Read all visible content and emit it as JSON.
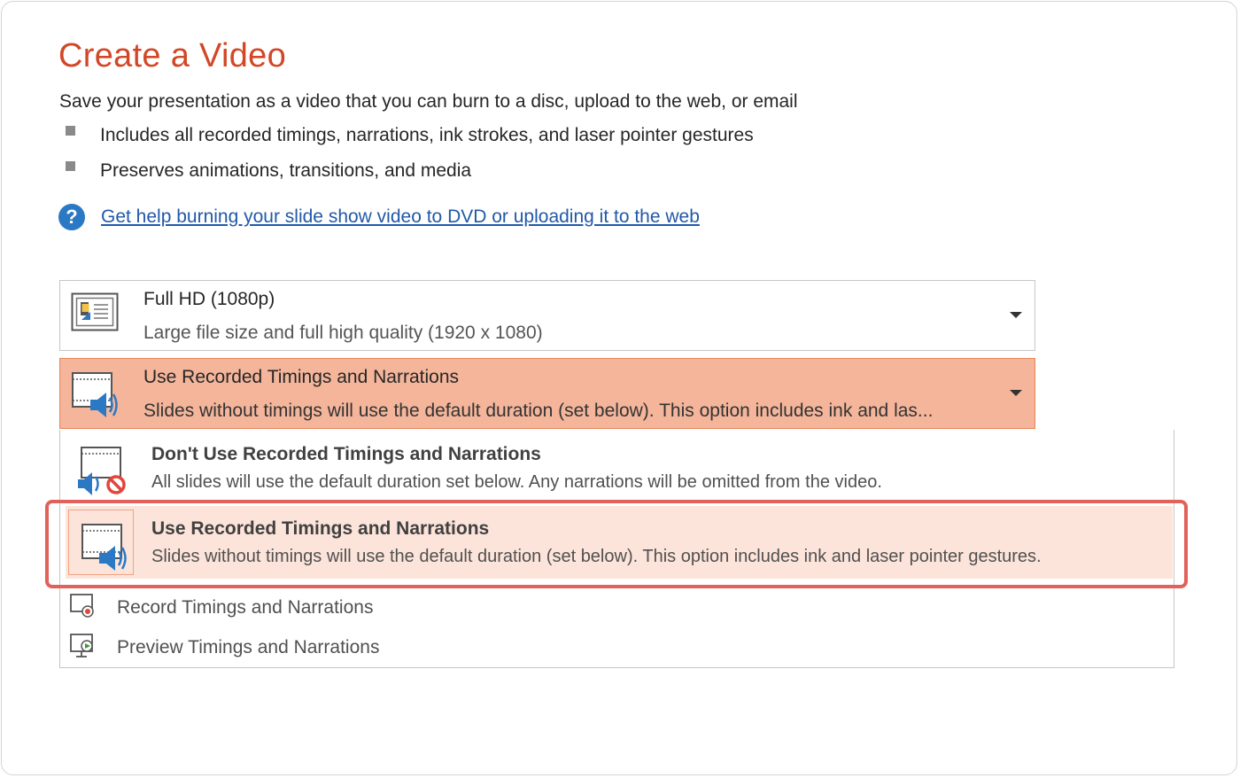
{
  "page": {
    "title": "Create a Video",
    "intro": "Save your presentation as a video that you can burn to a disc, upload to the web, or email",
    "bullets": [
      "Includes all recorded timings, narrations, ink strokes, and laser pointer gestures",
      "Preserves animations, transitions, and media"
    ],
    "help_link": "Get help burning your slide show video to DVD or uploading it to the web"
  },
  "quality_dropdown": {
    "title": "Full HD (1080p)",
    "desc": "Large file size and full high quality (1920 x 1080)",
    "icon": "presentation-quality-icon"
  },
  "timings_dropdown": {
    "title": "Use Recorded Timings and Narrations",
    "desc": "Slides without timings will use the default duration (set below). This option includes ink and las...",
    "icon": "timings-narrations-icon"
  },
  "menu": {
    "options": [
      {
        "title": "Don't Use Recorded Timings and Narrations",
        "desc": "All slides will use the default duration set below. Any narrations will be omitted from the video.",
        "icon": "no-narrations-icon"
      },
      {
        "title": "Use Recorded Timings and Narrations",
        "desc": "Slides without timings will use the default duration (set below). This option includes ink and laser pointer gestures.",
        "icon": "timings-narrations-icon",
        "selected": true
      }
    ],
    "actions": [
      {
        "label": "Record Timings and Narrations",
        "icon": "record-icon"
      },
      {
        "label": "Preview Timings and Narrations",
        "icon": "preview-icon"
      }
    ]
  },
  "colors": {
    "title": "#d24726",
    "active_dropdown": "#f4b59a",
    "selected_option": "#fce4da",
    "highlight": "#e0625a",
    "link": "#2159a8"
  }
}
